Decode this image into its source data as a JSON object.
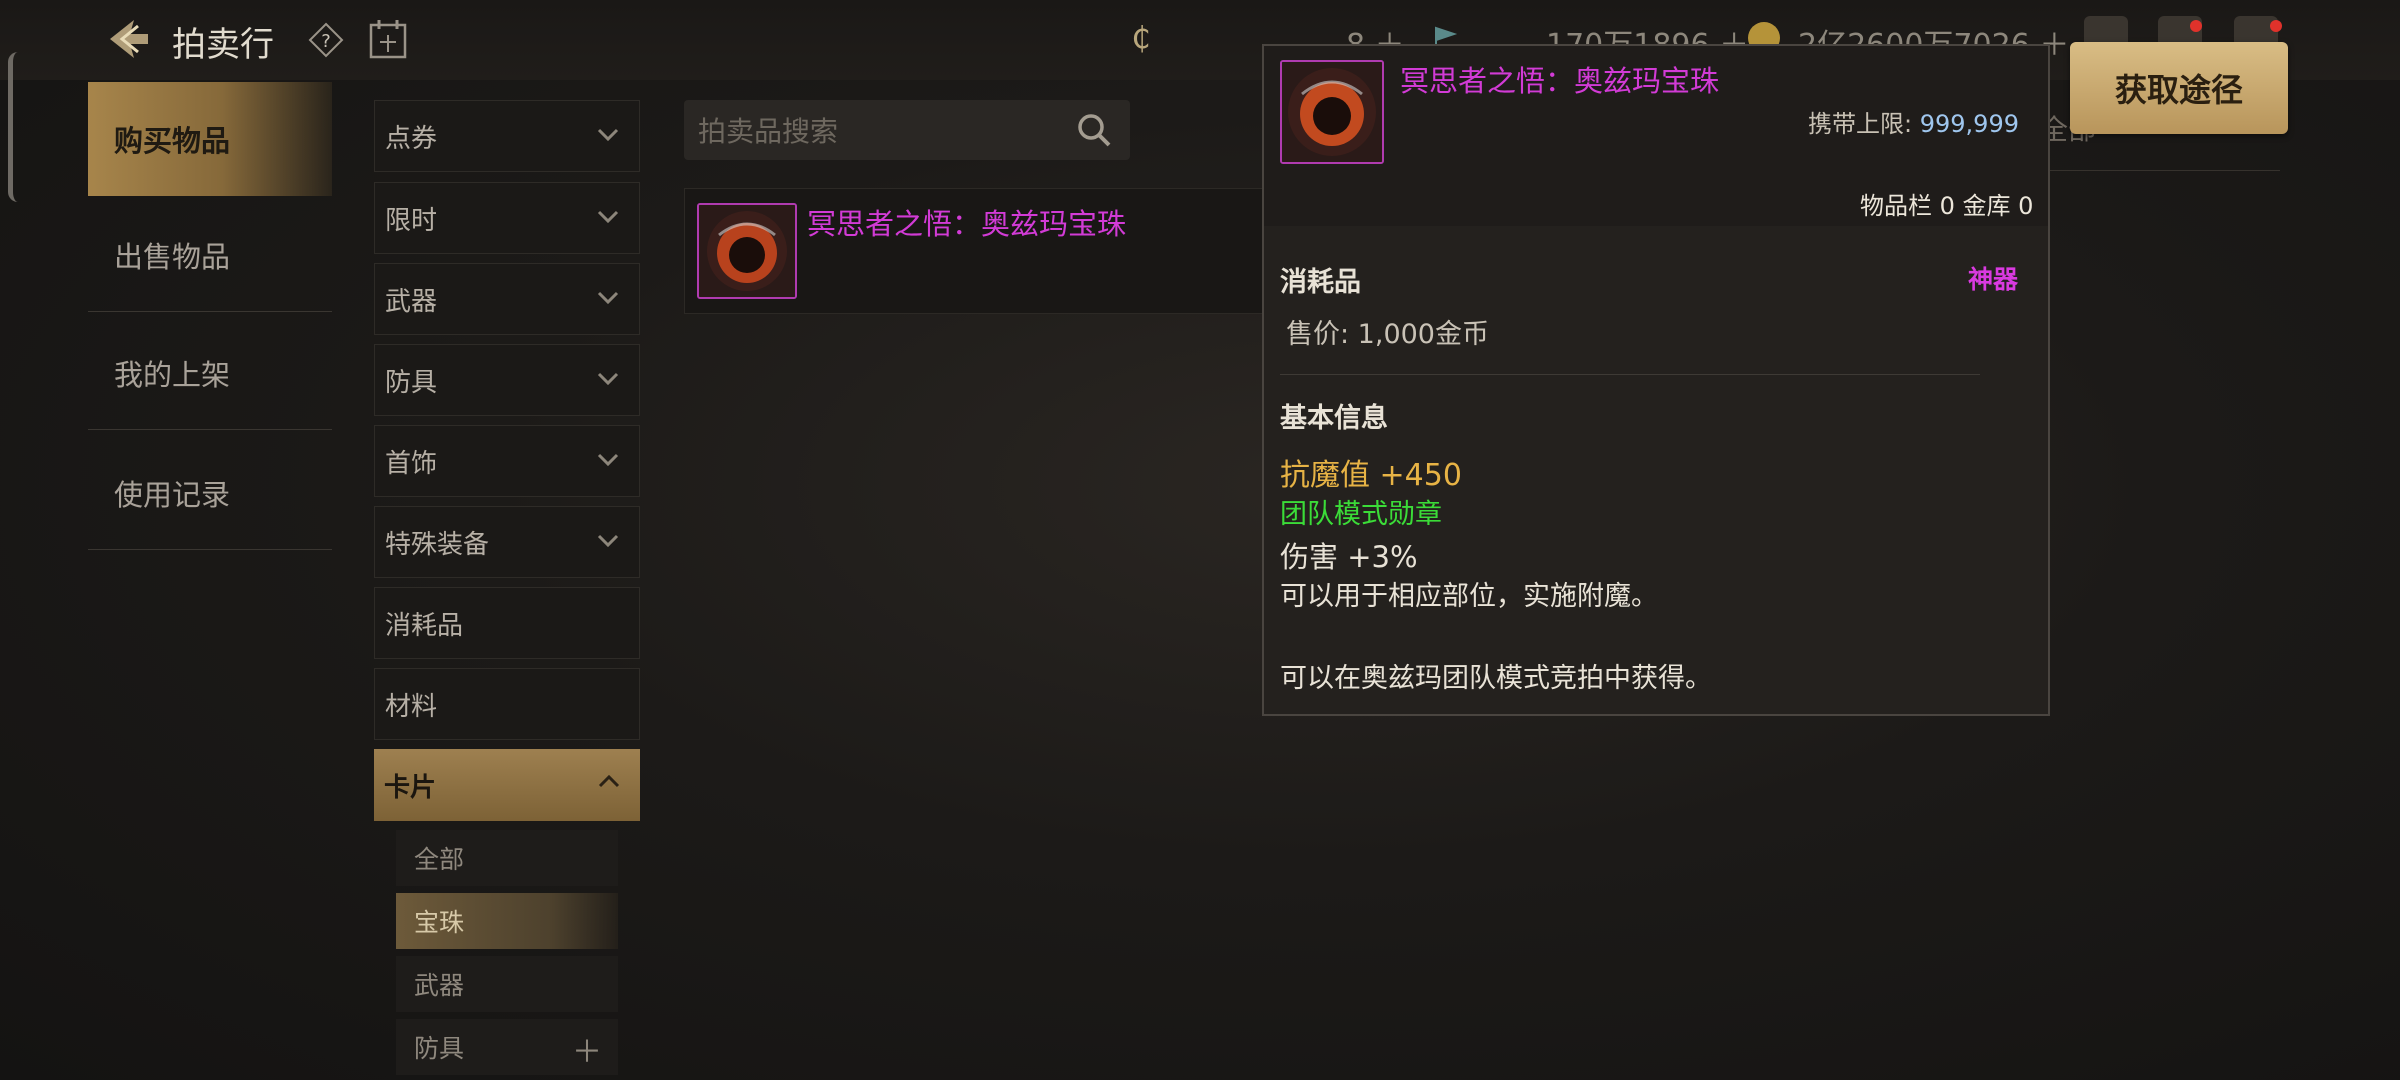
{
  "header": {
    "title": "拍卖行",
    "currency_a": "8",
    "currency_b": "170万1896",
    "currency_c": "2亿2600万7026"
  },
  "nav": {
    "items": [
      {
        "label": "购买物品",
        "active": true
      },
      {
        "label": "出售物品"
      },
      {
        "label": "我的上架"
      },
      {
        "label": "使用记录"
      }
    ]
  },
  "categories": {
    "items": [
      {
        "label": "点券"
      },
      {
        "label": "限时"
      },
      {
        "label": "武器"
      },
      {
        "label": "防具"
      },
      {
        "label": "首饰"
      },
      {
        "label": "特殊装备"
      },
      {
        "label": "消耗品"
      },
      {
        "label": "材料"
      },
      {
        "label": "卡片",
        "active": true
      }
    ],
    "subitems": [
      {
        "label": "全部"
      },
      {
        "label": "宝珠",
        "active": true
      },
      {
        "label": "武器"
      },
      {
        "label": "防具"
      }
    ]
  },
  "search": {
    "placeholder": "拍卖品搜索"
  },
  "filter": {
    "value": "全部"
  },
  "results": [
    {
      "name": "冥思者之悟：奥兹玛宝珠"
    }
  ],
  "tooltip": {
    "name": "冥思者之悟：奥兹玛宝珠",
    "carry_limit_label": "携带上限:",
    "carry_limit_value": "999,999",
    "inventory": "物品栏 0 金库 0",
    "type": "消耗品",
    "rarity": "神器",
    "price": "售价: 1,000金币",
    "section_title": "基本信息",
    "stat1": "抗魔值 +450",
    "stat2": "团队模式勋章",
    "stat3": "伤害 +3%",
    "desc1": "可以用于相应部位，实施附魔。",
    "desc2": "可以在奥兹玛团队模式竞拍中获得。"
  },
  "get_button": {
    "label": "获取途径"
  },
  "colors": {
    "accent_gold": "#a7854b",
    "item_name": "#d23bd6",
    "stat_gold": "#e7b345",
    "stat_green": "#3bdc38",
    "button": "#d9bd85"
  }
}
